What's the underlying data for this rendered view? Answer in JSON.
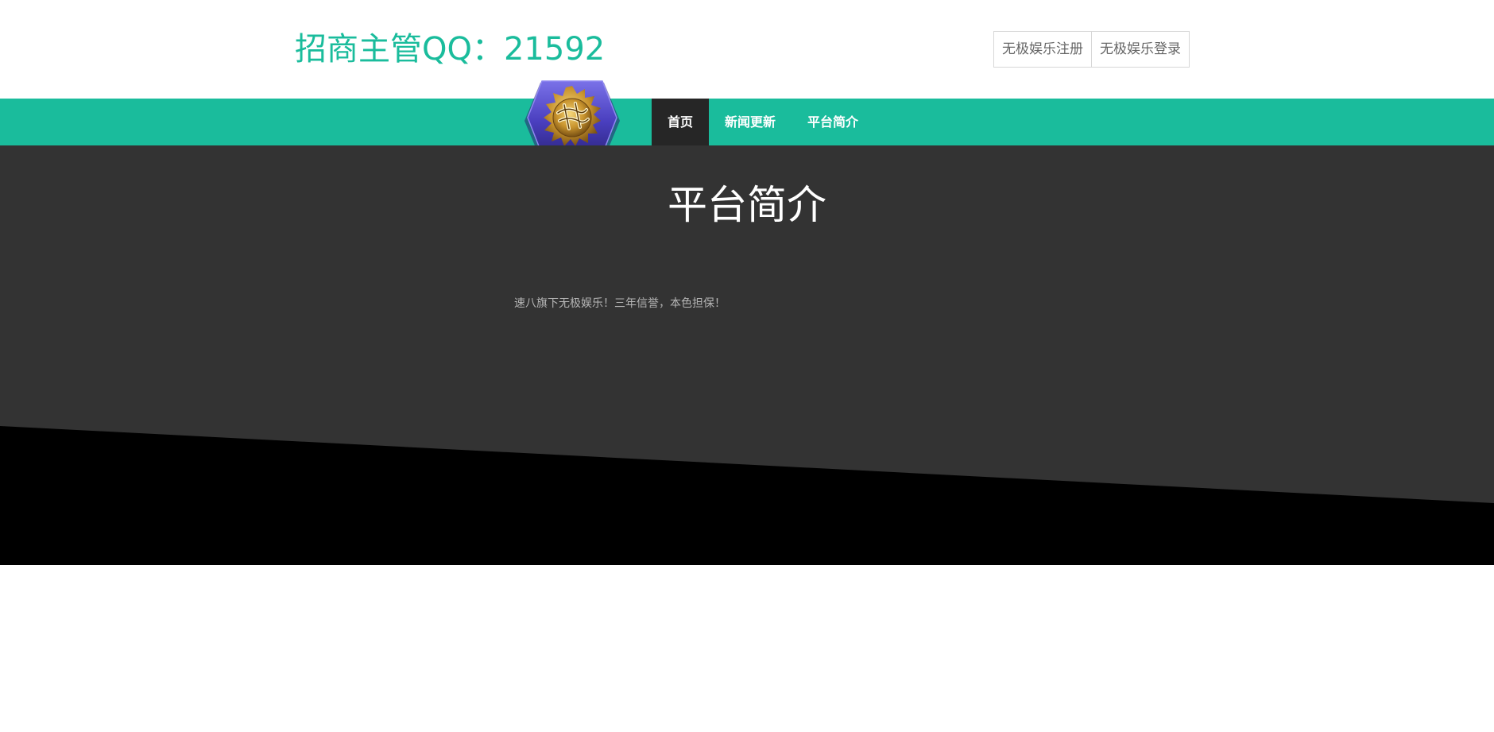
{
  "header": {
    "title": "招商主管QQ：21592",
    "register_label": "无极娱乐注册",
    "login_label": "无极娱乐登录"
  },
  "nav": {
    "items": [
      {
        "label": "首页",
        "active": true
      },
      {
        "label": "新闻更新",
        "active": false
      },
      {
        "label": "平台简介",
        "active": false
      }
    ]
  },
  "main": {
    "title": "平台简介",
    "body": "速八旗下无极娱乐！三年信誉，本色担保！"
  },
  "colors": {
    "accent": "#1abc9c",
    "nav_active": "#262626",
    "section_bg": "#333333",
    "diagonal": "#000000"
  },
  "icons": {
    "logo": "hexagon-gold-emblem-logo"
  }
}
